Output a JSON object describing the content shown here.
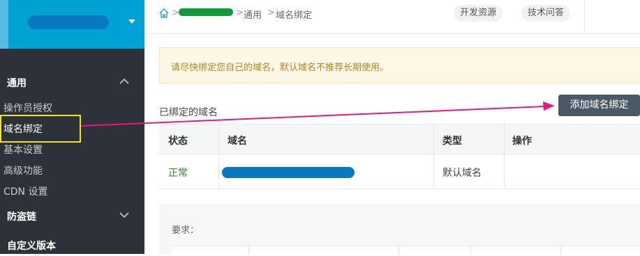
{
  "sidebar": {
    "sections": [
      {
        "title": "通用"
      },
      {
        "title": "防盗链"
      },
      {
        "title": "自定义版本"
      }
    ],
    "items": [
      {
        "label": "操作员授权"
      },
      {
        "label": "域名绑定"
      },
      {
        "label": "基本设置"
      },
      {
        "label": "高级功能"
      },
      {
        "label": "CDN 设置"
      }
    ]
  },
  "header": {
    "breadcrumb": [
      "通用",
      "域名绑定"
    ],
    "links": [
      "开发资源",
      "技术问答"
    ]
  },
  "notice": {
    "text": "请尽快绑定您自己的域名，默认域名不推荐长期使用。"
  },
  "main": {
    "section_title": "已绑定的域名",
    "add_button": "添加域名绑定",
    "table": {
      "headers": [
        "状态",
        "域名",
        "类型",
        "操作"
      ],
      "rows": [
        {
          "status": "正常",
          "type": "默认域名"
        }
      ]
    },
    "requirements_label": "要求："
  },
  "colors": {
    "sidebar_bg": "#2d3238",
    "sidebar_top": "#00a2d4",
    "status_ok": "#2e8b2e",
    "notice_text": "#b48426",
    "button_bg": "#4b5966",
    "annotation_arrow": "#e6197a",
    "annotation_box": "#f0e32a"
  }
}
